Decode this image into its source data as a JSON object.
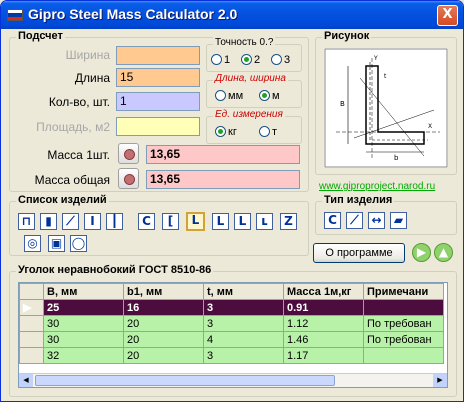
{
  "window": {
    "title": "Gipro Steel Mass Calculator 2.0",
    "close_label": "X",
    "flag_colors": [
      "#ffffff",
      "#0039a6",
      "#d52b1e"
    ]
  },
  "calc": {
    "group_title": "Подсчет",
    "width_label": "Ширина",
    "length_label": "Длина",
    "length_value": "15",
    "count_label": "Кол-во, шт.",
    "count_value": "1",
    "area_label": "Площадь, м2",
    "mass_one_label": "Масса 1шт.",
    "mass_one_value": "13,65",
    "mass_total_label": "Масса общая",
    "mass_total_value": "13,65"
  },
  "precision": {
    "title": "Точность 0.?",
    "options": [
      "1",
      "2",
      "3"
    ],
    "selected": "2"
  },
  "units_length": {
    "title": "Длина, ширина",
    "options": [
      "мм",
      "м"
    ],
    "selected": "м"
  },
  "units_measure": {
    "title": "Ед. измерения",
    "options": [
      "кг",
      "т"
    ],
    "selected": "кг"
  },
  "drawing": {
    "title": "Рисунок",
    "link": "www.giproproject.narod.ru"
  },
  "products": {
    "title": "Список изделий",
    "icons": [
      "channel-icon",
      "plate-icon",
      "rod-icon",
      "i-beam-icon",
      "t-icon",
      "c-icon",
      "channel-large-icon",
      "angle-selected-icon",
      "angle-icon",
      "angle-small-icon",
      "hook-icon",
      "z-icon",
      "pipe-icon",
      "square-pipe-icon",
      "ring-icon"
    ]
  },
  "product_type": {
    "title": "Тип изделия",
    "icons": [
      "c-type-icon",
      "bar-type-icon",
      "arrow-type-icon",
      "sheet-type-icon"
    ]
  },
  "about_button": "О программе",
  "table": {
    "title": "Уголок неравнобокий ГОСТ 8510-86",
    "columns": [
      "В, мм",
      "b1, мм",
      "t, мм",
      "Масса 1м,кг",
      "Примечани"
    ],
    "rows": [
      [
        "25",
        "16",
        "3",
        "0.91",
        ""
      ],
      [
        "30",
        "20",
        "3",
        "1.12",
        "По требован"
      ],
      [
        "30",
        "20",
        "4",
        "1.46",
        "По требован"
      ],
      [
        "32",
        "20",
        "3",
        "1.17",
        ""
      ]
    ],
    "selected_row": 0
  }
}
